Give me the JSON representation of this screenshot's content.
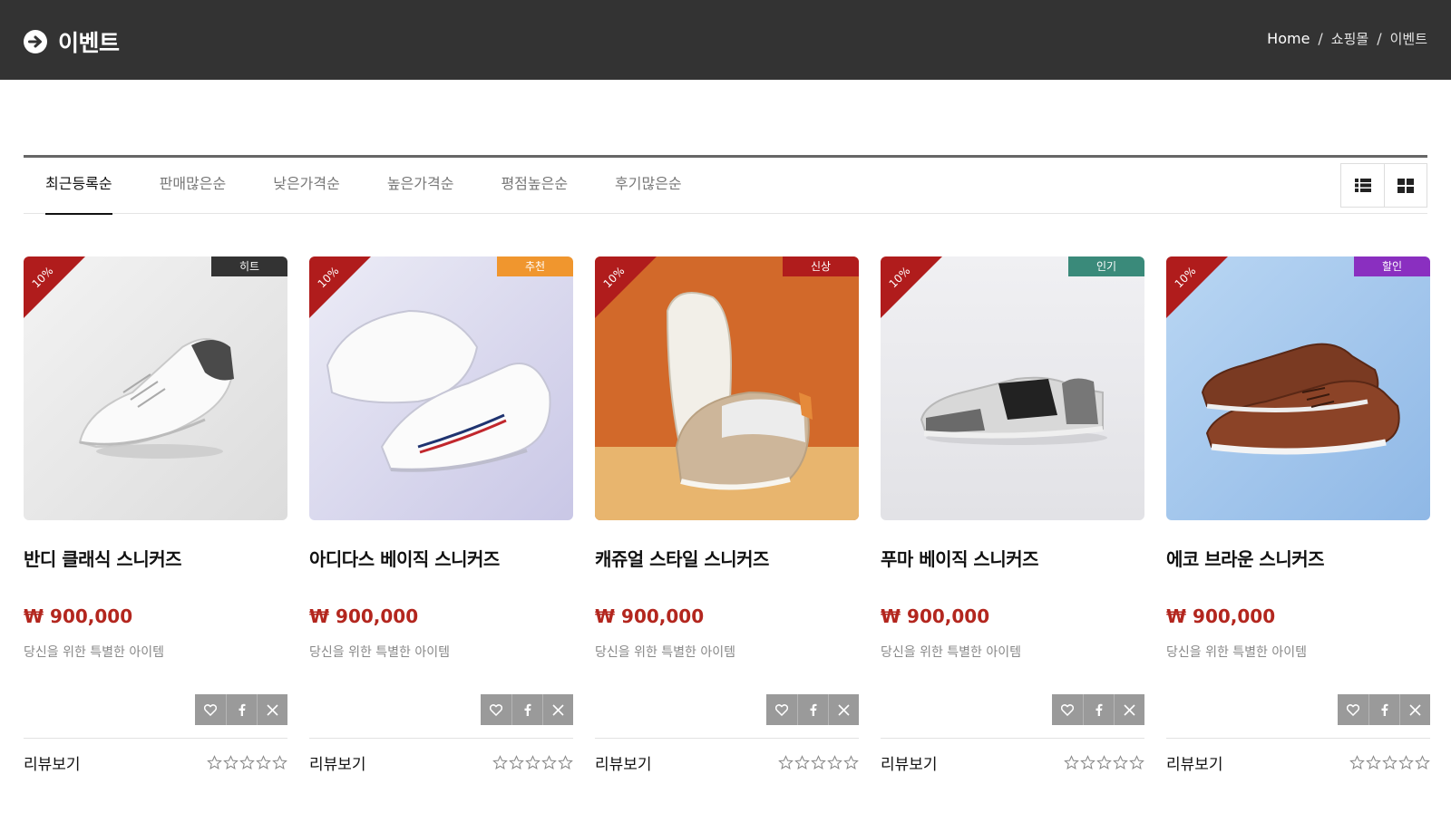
{
  "header": {
    "title": "이벤트",
    "breadcrumb": [
      "Home",
      "쇼핑몰",
      "이벤트"
    ]
  },
  "sort_tabs": [
    "최근등록순",
    "판매많은순",
    "낮은가격순",
    "높은가격순",
    "평점높은순",
    "후기많은순"
  ],
  "active_sort": "최근등록순",
  "view_modes": [
    "list-view",
    "grid-view"
  ],
  "products": [
    {
      "name": "반디 클래식 스니커즈",
      "price": "₩ 900,000",
      "description": "당신을 위한 특별한 아이템",
      "discount": "10%",
      "badge": "히트",
      "badge_color": "#333333",
      "rating": 0,
      "review_label": "리뷰보기"
    },
    {
      "name": "아디다스 베이직 스니커즈",
      "price": "₩ 900,000",
      "description": "당신을 위한 특별한 아이템",
      "discount": "10%",
      "badge": "추천",
      "badge_color": "#f0962e",
      "rating": 0,
      "review_label": "리뷰보기"
    },
    {
      "name": "캐쥬얼 스타일 스니커즈",
      "price": "₩ 900,000",
      "description": "당신을 위한 특별한 아이템",
      "discount": "10%",
      "badge": "신상",
      "badge_color": "#b01c1c",
      "rating": 0,
      "review_label": "리뷰보기"
    },
    {
      "name": "푸마 베이직 스니커즈",
      "price": "₩ 900,000",
      "description": "당신을 위한 특별한 아이템",
      "discount": "10%",
      "badge": "인기",
      "badge_color": "#3a8a7a",
      "rating": 0,
      "review_label": "리뷰보기"
    },
    {
      "name": "에코 브라운 스니커즈",
      "price": "₩ 900,000",
      "description": "당신을 위한 특별한 아이템",
      "discount": "10%",
      "badge": "할인",
      "badge_color": "#8a2fc0",
      "rating": 0,
      "review_label": "리뷰보기"
    }
  ],
  "share_icons": [
    "heart-icon",
    "facebook-icon",
    "x-icon"
  ],
  "colors": {
    "header_bg": "#333333",
    "price": "#b3261e",
    "ribbon": "#b01c1c",
    "share_bg": "#9a9a9a"
  }
}
